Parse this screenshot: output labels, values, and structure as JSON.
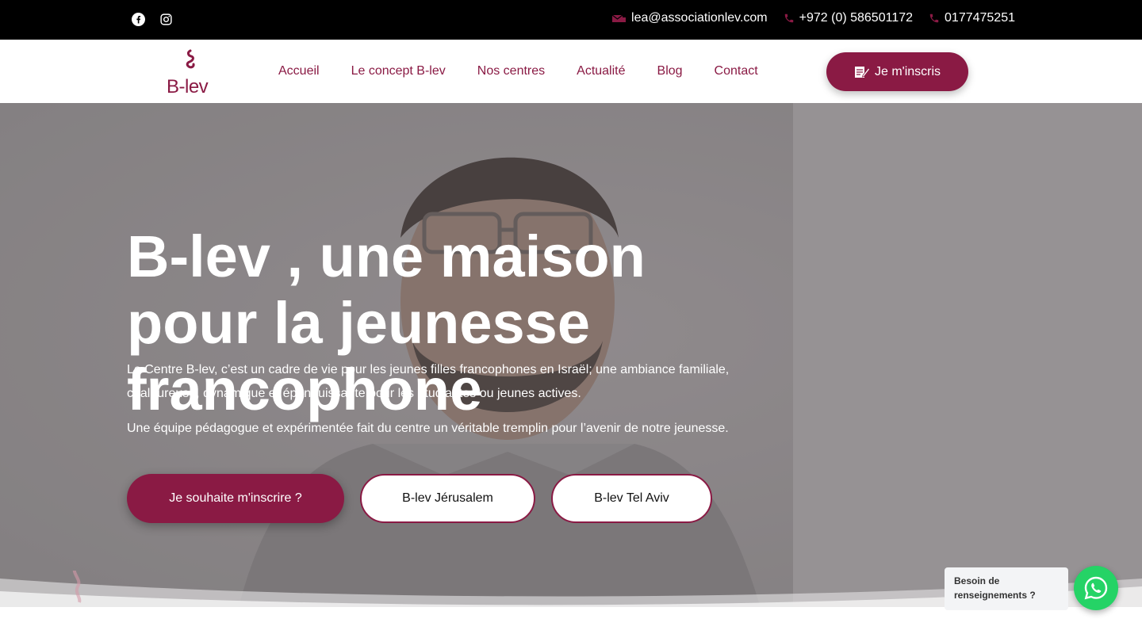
{
  "topbar": {
    "email": "lea@associationlev.com",
    "phone_1": "+972 (0) 586501172",
    "phone_2": "0177475251",
    "social": [
      "facebook-icon",
      "instagram-icon"
    ]
  },
  "brand": {
    "logo_text": "B-lev"
  },
  "nav": {
    "items": [
      {
        "label": "Accueil"
      },
      {
        "label": "Le concept B-lev"
      },
      {
        "label": "Nos centres"
      },
      {
        "label": "Actualité"
      },
      {
        "label": "Blog"
      },
      {
        "label": "Contact"
      }
    ],
    "cta_label": "Je m'inscris"
  },
  "hero": {
    "title": "B-lev , une maison pour la jeunesse francophone",
    "paragraph_1": "Le Centre B-lev, c’est un cadre de vie pour les jeunes filles francophones en Israël; une ambiance familiale, chaleureuse, dynamique et épanouissante pour les étudiantes ou jeunes actives.",
    "paragraph_2": "Une équipe pédagogue et expérimentée fait du centre un véritable tremplin pour l’avenir de notre jeunesse.",
    "buttons": [
      {
        "label": "Je souhaite m'inscrire ?"
      },
      {
        "label": "B-lev Jérusalem"
      },
      {
        "label": "B-lev Tel Aviv"
      }
    ]
  },
  "widget": {
    "help_text": "Besoin de renseignements ?"
  },
  "colors": {
    "brand": "#8a1a44",
    "topbar": "#000000",
    "whatsapp": "#25d366"
  }
}
